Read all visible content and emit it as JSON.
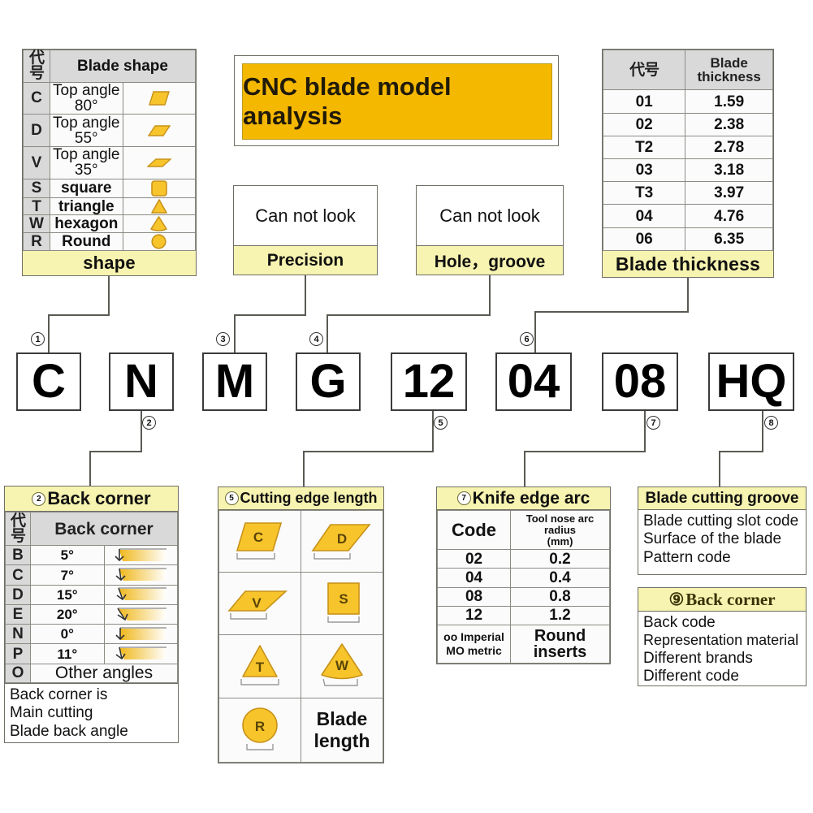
{
  "title": {
    "text": "CNC blade model analysis",
    "accent": "#F5B800"
  },
  "blade_shape_panel": {
    "code_header": "代号",
    "header": "Blade shape",
    "footer": "shape",
    "rows": [
      {
        "code": "C",
        "desc": "Top angle 80°",
        "icon": "rhombus-80-icon"
      },
      {
        "code": "D",
        "desc": "Top angle 55°",
        "icon": "rhombus-55-icon"
      },
      {
        "code": "V",
        "desc": "Top angle 35°",
        "icon": "rhombus-35-icon"
      },
      {
        "code": "S",
        "desc": "square",
        "icon": "square-icon"
      },
      {
        "code": "T",
        "desc": "triangle",
        "icon": "triangle-icon"
      },
      {
        "code": "W",
        "desc": "hexagon",
        "icon": "trigon-icon"
      },
      {
        "code": "R",
        "desc": "Round",
        "icon": "circle-icon"
      }
    ]
  },
  "precision_panel": {
    "body": "Can not look",
    "footer": "Precision"
  },
  "hole_groove_panel": {
    "body": "Can not look",
    "footer": "Hole，groove"
  },
  "blade_thickness_panel": {
    "code_header": "代号",
    "header": "Blade thickness",
    "footer": "Blade thickness",
    "rows": [
      {
        "code": "01",
        "value": "1.59"
      },
      {
        "code": "02",
        "value": "2.38"
      },
      {
        "code": "T2",
        "value": "2.78"
      },
      {
        "code": "03",
        "value": "3.18"
      },
      {
        "code": "T3",
        "value": "3.97"
      },
      {
        "code": "04",
        "value": "4.76"
      },
      {
        "code": "06",
        "value": "6.35"
      }
    ]
  },
  "code_string": {
    "boxes": [
      {
        "char": "C",
        "index": "①",
        "index_pos": "top"
      },
      {
        "char": "N",
        "index": "②",
        "index_pos": "bottom"
      },
      {
        "char": "M",
        "index": "③",
        "index_pos": "top"
      },
      {
        "char": "G",
        "index": "④",
        "index_pos": "top"
      },
      {
        "char": "12",
        "index": "⑤",
        "index_pos": "bottom"
      },
      {
        "char": "04",
        "index": "⑥",
        "index_pos": "top"
      },
      {
        "char": "08",
        "index": "⑦",
        "index_pos": "bottom"
      },
      {
        "char": "HQ",
        "index": "⑧",
        "index_pos": "bottom"
      }
    ]
  },
  "back_corner_panel": {
    "title_num": "②",
    "title": "Back corner",
    "code_header": "代号",
    "header": "Back corner",
    "rows": [
      {
        "code": "B",
        "angle": "5°"
      },
      {
        "code": "C",
        "angle": "7°"
      },
      {
        "code": "D",
        "angle": "15°"
      },
      {
        "code": "E",
        "angle": "20°"
      },
      {
        "code": "N",
        "angle": "0°"
      },
      {
        "code": "P",
        "angle": "11°"
      }
    ],
    "other_code": "O",
    "other_label": "Other angles",
    "notes": [
      "Back corner is",
      "Main cutting",
      "Blade back angle"
    ]
  },
  "cutting_edge_panel": {
    "title_num": "⑤",
    "title": "Cutting edge length",
    "cells": [
      {
        "letter": "C",
        "icon": "insert-rhombus-80-icon"
      },
      {
        "letter": "D",
        "icon": "insert-rhombus-55-icon"
      },
      {
        "letter": "V",
        "icon": "insert-rhombus-35-icon"
      },
      {
        "letter": "S",
        "icon": "insert-square-icon"
      },
      {
        "letter": "T",
        "icon": "insert-triangle-icon"
      },
      {
        "letter": "W",
        "icon": "insert-trigon-icon"
      },
      {
        "letter": "R",
        "icon": "insert-round-icon"
      }
    ],
    "caption_line1": "Blade",
    "caption_line2": "length"
  },
  "knife_edge_panel": {
    "title_num": "⑦",
    "title": "Knife edge arc",
    "col_code": "Code",
    "col_radius": "Tool nose arc radius",
    "col_radius_unit": "(mm)",
    "rows": [
      {
        "code": "02",
        "radius": "0.2"
      },
      {
        "code": "04",
        "radius": "0.4"
      },
      {
        "code": "08",
        "radius": "0.8"
      },
      {
        "code": "12",
        "radius": "1.2"
      }
    ],
    "note_line1": "oo Imperial",
    "note_line2": "MO metric",
    "note_value": "Round inserts"
  },
  "cutting_groove_panel": {
    "title": "Blade cutting groove",
    "lines": [
      "Blade cutting slot code",
      "Surface of the blade",
      "Pattern code"
    ]
  },
  "back_corner9_panel": {
    "title_num": "⑨",
    "title": "Back  corner",
    "lines": [
      "Back code",
      "Representation material",
      "Different brands",
      "Different code"
    ]
  },
  "colors": {
    "accent_gold": "#F5B800",
    "pale_yellow": "#f7f3b0",
    "insert_fill": "#F7C52B",
    "insert_stroke": "#c8921a",
    "grey_code": "#d9d9d9",
    "line": "#5a5a54"
  }
}
